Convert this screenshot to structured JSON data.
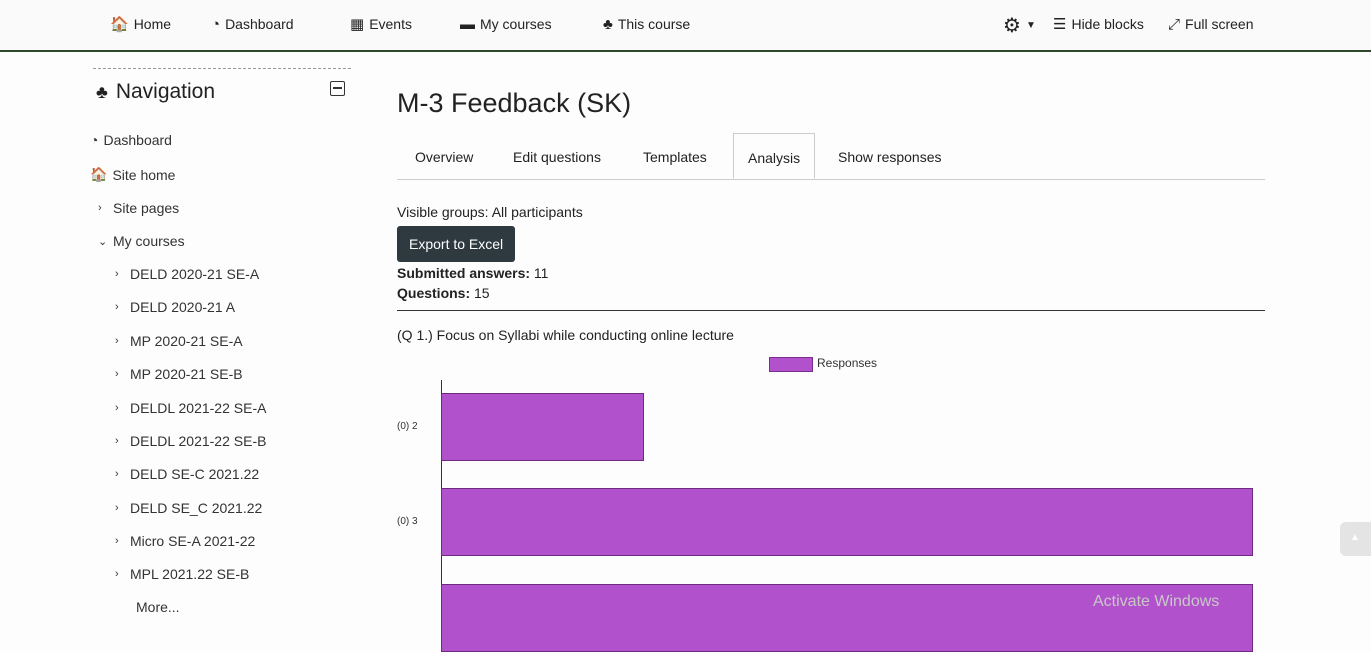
{
  "topnav": {
    "items": [
      {
        "label": "Home",
        "icon": "home-icon",
        "glyph": "🏠"
      },
      {
        "label": "Dashboard",
        "icon": "dashboard-icon",
        "glyph": "◔"
      },
      {
        "label": "Events",
        "icon": "calendar-icon",
        "glyph": "▦"
      },
      {
        "label": "My courses",
        "icon": "briefcase-icon",
        "glyph": "▬"
      },
      {
        "label": "This course",
        "icon": "sitemap-icon",
        "glyph": "♣"
      }
    ],
    "settings_icon": "gear-icon",
    "hide_blocks_label": "Hide blocks",
    "full_screen_label": "Full screen"
  },
  "sidebar": {
    "title": "Navigation",
    "items": [
      {
        "label": "Dashboard",
        "icon": "dashboard-icon"
      },
      {
        "label": "Site home",
        "icon": "home-icon"
      },
      {
        "label": "Site pages",
        "icon": "chevron-right-icon"
      },
      {
        "label": "My courses",
        "icon": "chevron-down-icon"
      }
    ],
    "courses": [
      "DELD 2020-21 SE-A",
      "DELD 2020-21 A",
      "MP 2020-21 SE-A",
      "MP 2020-21 SE-B",
      "DELDL 2021-22 SE-A",
      "DELDL 2021-22 SE-B",
      "DELD SE-C 2021.22",
      "DELD SE_C 2021.22",
      "Micro SE-A 2021-22",
      "MPL 2021.22 SE-B"
    ],
    "more_label": "More..."
  },
  "main": {
    "title": "M-3 Feedback (SK)",
    "tabs": [
      "Overview",
      "Edit questions",
      "Templates",
      "Analysis",
      "Show responses"
    ],
    "active_tab": "Analysis",
    "visible_groups": "Visible groups: All participants",
    "export_label": "Export to Excel",
    "submitted_label": "Submitted answers:",
    "submitted_value": "11",
    "questions_label": "Questions:",
    "questions_value": "15",
    "question_title": "(Q 1.) Focus on Syllabi while conducting online lecture"
  },
  "chart_data": {
    "type": "bar",
    "orientation": "horizontal",
    "categories": [
      "(0) 2",
      "(0) 3",
      ""
    ],
    "series": [
      {
        "name": "Responses",
        "values": [
          2,
          8,
          8
        ]
      }
    ],
    "color": "#b152cc",
    "legend": "top"
  },
  "watermark": "Activate Windows"
}
